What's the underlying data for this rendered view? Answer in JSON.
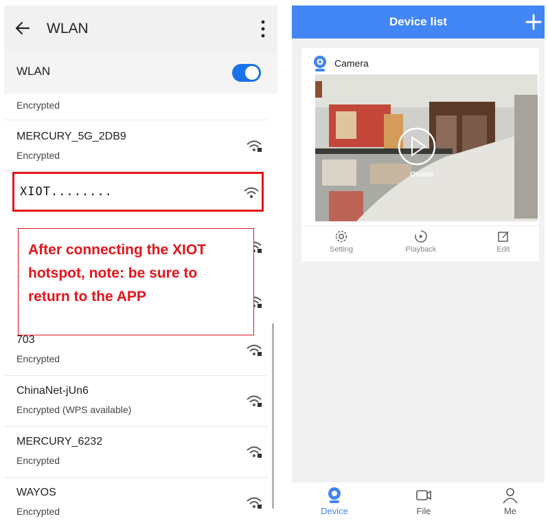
{
  "left": {
    "title": "WLAN",
    "wlan_label": "WLAN",
    "wlan_enabled": true,
    "partial_status": "Encrypted",
    "networks_top": [
      {
        "name": "MERCURY_5G_2DB9",
        "status": "Encrypted"
      }
    ],
    "highlighted_network": "XIOT........",
    "networks_bottom": [
      {
        "name": "703",
        "status": "Encrypted"
      },
      {
        "name": "ChinaNet-jUn6",
        "status": "Encrypted (WPS available)"
      },
      {
        "name": "MERCURY_6232",
        "status": "Encrypted"
      },
      {
        "name": "WAYOS",
        "status": "Encrypted"
      }
    ],
    "callout_lines": [
      "After  connecting  the XIOT",
      "hotspot, note: be sure to",
      "return to the APP"
    ]
  },
  "right": {
    "header_title": "Device list",
    "device": {
      "name": "Camera",
      "status_overlay": "Online"
    },
    "actions": [
      {
        "label": "Setting",
        "icon": "gear-icon"
      },
      {
        "label": "Playback",
        "icon": "playback-icon"
      },
      {
        "label": "Edit",
        "icon": "edit-icon"
      }
    ],
    "tabs": [
      {
        "label": "Device",
        "icon": "camera-icon",
        "active": true
      },
      {
        "label": "File",
        "icon": "video-file-icon",
        "active": false
      },
      {
        "label": "Me",
        "icon": "person-icon",
        "active": false
      }
    ]
  },
  "colors": {
    "accent": "#4285f4",
    "highlight_red": "#e3141c",
    "toggle_blue": "#1a73e8"
  }
}
